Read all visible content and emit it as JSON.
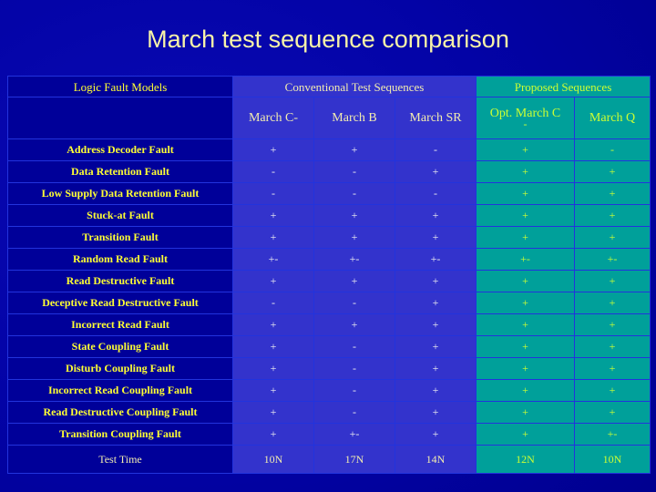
{
  "slide": {
    "title": "March test sequence comparison",
    "background_color": "#0000a0",
    "title_color": "#f7f3a8"
  },
  "colors": {
    "grid": "#2233dd",
    "navy_cell": "#000099",
    "blue_cell": "#3333cc",
    "teal_cell": "#00a09a",
    "yellow_text": "#ffff33",
    "cream_text": "#f2ecb0",
    "white_text": "#f0f0f0",
    "lime_text": "#ccff33"
  },
  "table": {
    "group_headers": {
      "label_column": "Logic Fault Models",
      "conventional": "Conventional Test Sequences",
      "proposed": "Proposed Sequences"
    },
    "column_headers": {
      "march_c_minus": "March C-",
      "march_b": "March B",
      "march_sr": "March SR",
      "opt_march_c_line1": "Opt. March C",
      "opt_march_c_line2": "-",
      "march_q": "March Q"
    },
    "rows": [
      {
        "label": "Address Decoder Fault",
        "march_c_minus": "+",
        "march_b": "+",
        "march_sr": "-",
        "opt_march_c": "+",
        "march_q": "-"
      },
      {
        "label": "Data Retention Fault",
        "march_c_minus": "-",
        "march_b": "-",
        "march_sr": "+",
        "opt_march_c": "+",
        "march_q": "+"
      },
      {
        "label": "Low Supply Data Retention Fault",
        "march_c_minus": "-",
        "march_b": "-",
        "march_sr": "-",
        "opt_march_c": "+",
        "march_q": "+"
      },
      {
        "label": "Stuck-at Fault",
        "march_c_minus": "+",
        "march_b": "+",
        "march_sr": "+",
        "opt_march_c": "+",
        "march_q": "+"
      },
      {
        "label": "Transition Fault",
        "march_c_minus": "+",
        "march_b": "+",
        "march_sr": "+",
        "opt_march_c": "+",
        "march_q": "+"
      },
      {
        "label": "Random Read Fault",
        "march_c_minus": "+-",
        "march_b": "+-",
        "march_sr": "+-",
        "opt_march_c": "+-",
        "march_q": "+-"
      },
      {
        "label": "Read Destructive Fault",
        "march_c_minus": "+",
        "march_b": "+",
        "march_sr": "+",
        "opt_march_c": "+",
        "march_q": "+"
      },
      {
        "label": "Deceptive Read Destructive Fault",
        "march_c_minus": "-",
        "march_b": "-",
        "march_sr": "+",
        "opt_march_c": "+",
        "march_q": "+"
      },
      {
        "label": "Incorrect Read Fault",
        "march_c_minus": "+",
        "march_b": "+",
        "march_sr": "+",
        "opt_march_c": "+",
        "march_q": "+"
      },
      {
        "label": "State Coupling Fault",
        "march_c_minus": "+",
        "march_b": "-",
        "march_sr": "+",
        "opt_march_c": "+",
        "march_q": "+"
      },
      {
        "label": "Disturb Coupling Fault",
        "march_c_minus": "+",
        "march_b": "-",
        "march_sr": "+",
        "opt_march_c": "+",
        "march_q": "+"
      },
      {
        "label": "Incorrect Read Coupling Fault",
        "march_c_minus": "+",
        "march_b": "-",
        "march_sr": "+",
        "opt_march_c": "+",
        "march_q": "+"
      },
      {
        "label": "Read Destructive Coupling Fault",
        "march_c_minus": "+",
        "march_b": "-",
        "march_sr": "+",
        "opt_march_c": "+",
        "march_q": "+"
      },
      {
        "label": "Transition Coupling Fault",
        "march_c_minus": "+",
        "march_b": "+-",
        "march_sr": "+",
        "opt_march_c": "+",
        "march_q": "+-"
      }
    ],
    "test_time": {
      "label": "Test Time",
      "march_c_minus": "10N",
      "march_b": "17N",
      "march_sr": "14N",
      "opt_march_c": "12N",
      "march_q": "10N"
    }
  }
}
